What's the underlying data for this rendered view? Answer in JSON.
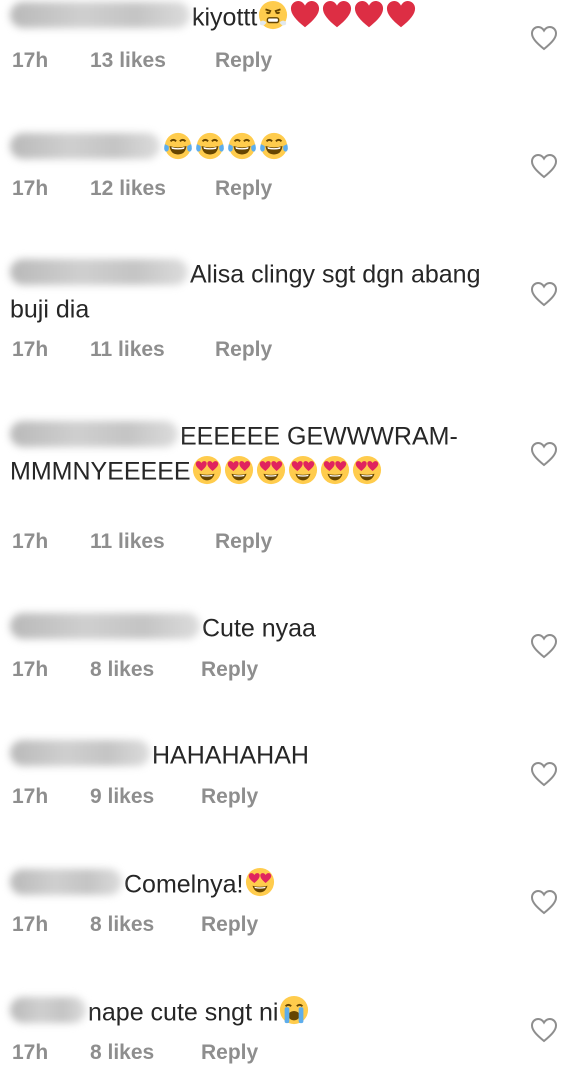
{
  "comments": [
    {
      "text": "kiyottt",
      "emoji_names": [
        "steam-from-nose-face",
        "red-heart",
        "red-heart",
        "red-heart",
        "red-heart"
      ],
      "time": "17h",
      "likes": "13 likes",
      "reply_label": "Reply"
    },
    {
      "text": "",
      "emoji_names": [
        "tears-of-joy-face",
        "tears-of-joy-face",
        "tears-of-joy-face",
        "tears-of-joy-face"
      ],
      "time": "17h",
      "likes": "12 likes",
      "reply_label": "Reply"
    },
    {
      "text": "Alisa clingy sgt dgn abang buji dia",
      "emoji_names": [],
      "time": "17h",
      "likes": "11 likes",
      "reply_label": "Reply"
    },
    {
      "text": "EEEEEE GEWWWRAM-MMMNYEEEEE",
      "emoji_names": [
        "heart-eyes-face",
        "heart-eyes-face",
        "heart-eyes-face",
        "heart-eyes-face",
        "heart-eyes-face",
        "heart-eyes-face"
      ],
      "time": "17h",
      "likes": "11 likes",
      "reply_label": "Reply"
    },
    {
      "text": "Cute nyaa",
      "emoji_names": [],
      "time": "17h",
      "likes": "8 likes",
      "reply_label": "Reply"
    },
    {
      "text": "HAHAHAHAH",
      "emoji_names": [],
      "time": "17h",
      "likes": "9 likes",
      "reply_label": "Reply"
    },
    {
      "text": "Comelnya!",
      "emoji_names": [
        "heart-eyes-face"
      ],
      "time": "17h",
      "likes": "8 likes",
      "reply_label": "Reply"
    },
    {
      "text": "nape cute sngt ni",
      "emoji_names": [
        "loudly-crying-face"
      ],
      "time": "17h",
      "likes": "8 likes",
      "reply_label": "Reply"
    }
  ],
  "icons": {
    "like": "heart-outline-icon"
  },
  "colors": {
    "text": "#262626",
    "meta": "#8e8e8e",
    "heart_stroke": "#8e8e8e"
  }
}
